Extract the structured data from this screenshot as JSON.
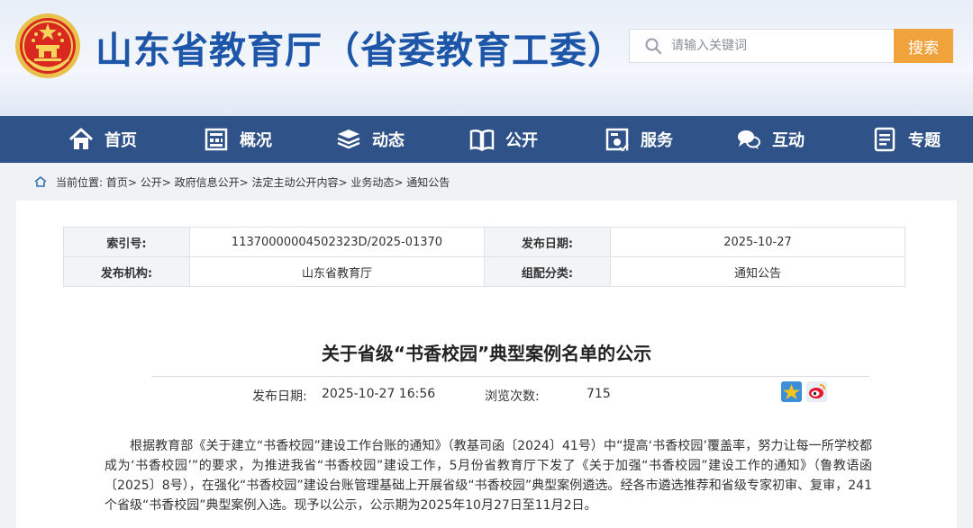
{
  "header": {
    "site_title": "山东省教育厅（省委教育工委）",
    "search_placeholder": "请输入关键词",
    "search_button": "搜索"
  },
  "nav": {
    "items": [
      {
        "label": "首页",
        "icon": "home-icon"
      },
      {
        "label": "概况",
        "icon": "building-icon"
      },
      {
        "label": "动态",
        "icon": "stack-icon"
      },
      {
        "label": "公开",
        "icon": "book-icon"
      },
      {
        "label": "服务",
        "icon": "service-icon"
      },
      {
        "label": "互动",
        "icon": "chat-icon"
      },
      {
        "label": "专题",
        "icon": "document-icon"
      }
    ]
  },
  "breadcrumb": {
    "text": "当前位置: 首页> 公开> 政府信息公开> 法定主动公开内容> 业务动态> 通知公告"
  },
  "meta": {
    "index_label": "索引号:",
    "index_value": "11370000004502323D/2025-01370",
    "date_label": "发布日期:",
    "date_value": "2025-10-27",
    "org_label": "发布机构:",
    "org_value": "山东省教育厅",
    "category_label": "组配分类:",
    "category_value": "通知公告"
  },
  "article": {
    "title": "关于省级“书香校园”典型案例名单的公示",
    "pub_label": "发布日期:",
    "pub_value": "2025-10-27 16:56",
    "views_label": "浏览次数:",
    "views_value": "715",
    "body": "根据教育部《关于建立“书香校园”建设工作台账的通知》（教基司函〔2024〕41号）中“提高‘书香校园’覆盖率，努力让每一所学校都成为‘书香校园’”的要求，为推进我省“书香校园”建设工作，5月份省教育厅下发了《关于加强“书香校园”建设工作的通知》（鲁教语函〔2025〕8号），在强化“书香校园”建设台账管理基础上开展省级“书香校园”典型案例遴选。经各市遴选推荐和省级专家初审、复审，241个省级“书香校园”典型案例入选。现予以公示，公示期为2025年10月27日至11月2日。"
  },
  "colors": {
    "title_blue": "#1d56a8",
    "nav_bg": "#2f5288",
    "search_btn": "#f0a23b"
  }
}
